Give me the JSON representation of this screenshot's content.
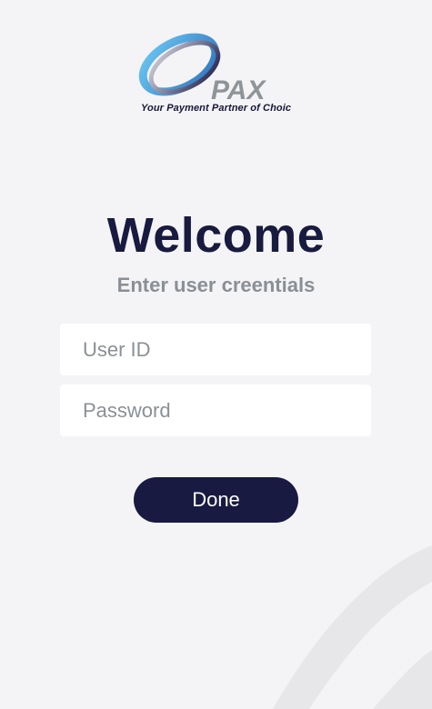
{
  "branding": {
    "logo_text": "PAX",
    "tagline": "Your Payment Partner of Choic"
  },
  "login": {
    "title": "Welcome",
    "subtitle": "Enter user creentials",
    "user_id_placeholder": "User ID",
    "password_placeholder": "Password",
    "done_label": "Done"
  },
  "colors": {
    "background": "#f4f4f6",
    "title": "#181a3f",
    "subtitle": "#8a8f95",
    "button": "#181a42",
    "logo_blue": "#3f9bd9"
  },
  "icons": {
    "brand_logo": "pax-swirl-logo"
  }
}
